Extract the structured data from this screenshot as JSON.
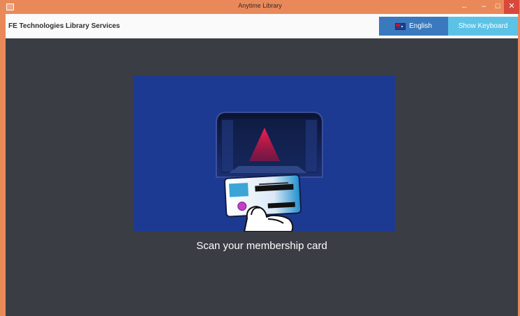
{
  "window": {
    "title": "Anytime Library"
  },
  "window_controls": {
    "resize": "↔",
    "minimize": "–",
    "maximize": "☐",
    "close": "✕"
  },
  "header": {
    "brand": "FE Technologies Library Services",
    "language_button": "English",
    "language_flag": "flag-icon",
    "keyboard_button": "Show Keyboard"
  },
  "main": {
    "instruction": "Scan your membership card"
  },
  "colors": {
    "title_bar": "#e9895a",
    "header_bg": "#fafafa",
    "language_button": "#3a79bd",
    "keyboard_button": "#5cc3e6",
    "content_bg": "#3b3d45",
    "illustration_bg": "#1d3a92",
    "scanner_light": "#d0143c",
    "close_button": "#d9483b"
  }
}
